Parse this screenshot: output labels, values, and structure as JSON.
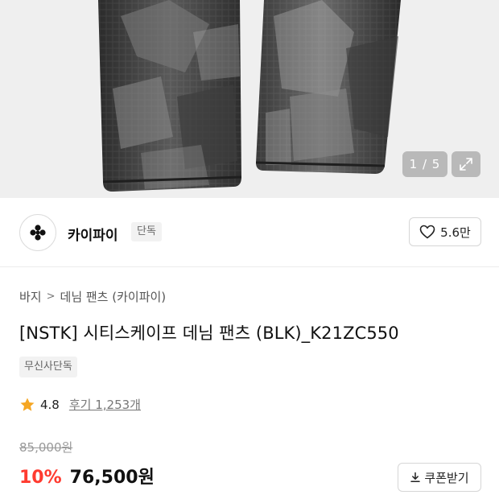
{
  "gallery": {
    "pager_text": "1 / 5",
    "expand_icon": "expand-icon"
  },
  "brand": {
    "logo_icon": "clover-logo-icon",
    "name": "카이파이",
    "badge": "단독",
    "like_count": "5.6만",
    "like_icon": "heart-outline-icon"
  },
  "breadcrumb": {
    "category": "바지",
    "separator": ">",
    "subcategory": "데님 팬츠 (카이파이)"
  },
  "product": {
    "title": "[NSTK] 시티스케이프 데님 팬츠 (BLK)_K21ZC550",
    "tag": "무신사단독"
  },
  "rating": {
    "star_icon": "star-icon",
    "value": "4.8",
    "reviews_label": "후기 1,253개",
    "star_color": "#f5a623"
  },
  "price": {
    "original": "85,000원",
    "discount": "10%",
    "sale": "76,500원",
    "discount_color": "#ff3b30",
    "coupon_label": "쿠폰받기",
    "coupon_icon": "download-icon"
  }
}
